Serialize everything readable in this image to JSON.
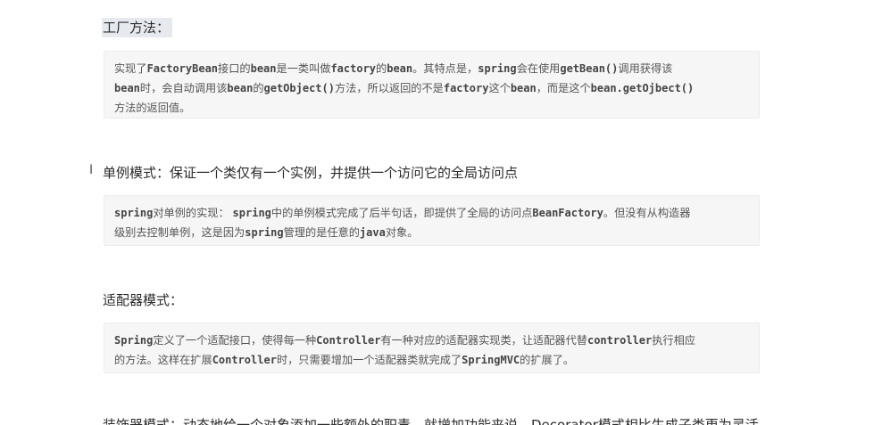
{
  "sections": [
    {
      "heading": "工厂方法：",
      "paragraph": [
        {
          "t": "实现了"
        },
        {
          "t": "FactoryBean",
          "code": true
        },
        {
          "t": "接口的"
        },
        {
          "t": "bean",
          "code": true
        },
        {
          "t": "是一类叫做"
        },
        {
          "t": "factory",
          "code": true
        },
        {
          "t": "的"
        },
        {
          "t": "bean",
          "code": true
        },
        {
          "t": "。其特点是，"
        },
        {
          "t": "spring",
          "code": true
        },
        {
          "t": "会在使用"
        },
        {
          "t": "getBean()",
          "code": true
        },
        {
          "t": "调用获得该"
        },
        {
          "br": true
        },
        {
          "t": "bean",
          "code": true
        },
        {
          "t": "时，会自动调用该"
        },
        {
          "t": "bean",
          "code": true
        },
        {
          "t": "的"
        },
        {
          "t": "getObject()",
          "code": true
        },
        {
          "t": "方法，所以返回的不是"
        },
        {
          "t": "factory",
          "code": true
        },
        {
          "t": "这个"
        },
        {
          "t": "bean",
          "code": true
        },
        {
          "t": "，而是这个"
        },
        {
          "t": "bean.getOjbect()",
          "code": true
        },
        {
          "br": true
        },
        {
          "t": "方法的返回值。"
        }
      ]
    },
    {
      "heading": "单例模式：保证一个类仅有一个实例，并提供一个访问它的全局访问点",
      "paragraph": [
        {
          "t": "spring",
          "code": true
        },
        {
          "t": "对单例的实现：  "
        },
        {
          "t": "spring",
          "code": true
        },
        {
          "t": "中的单例模式完成了后半句话，即提供了全局的访问点"
        },
        {
          "t": "BeanFactory",
          "code": true
        },
        {
          "t": "。但没有从构造器"
        },
        {
          "br": true
        },
        {
          "t": "级别去控制单例，这是因为"
        },
        {
          "t": "spring",
          "code": true
        },
        {
          "t": "管理的是任意的"
        },
        {
          "t": "java",
          "code": true
        },
        {
          "t": "对象。"
        }
      ]
    },
    {
      "heading": "适配器模式：",
      "paragraph": [
        {
          "t": "Spring",
          "code": true
        },
        {
          "t": "定义了一个适配接口，使得每一种"
        },
        {
          "t": "Controller",
          "code": true
        },
        {
          "t": "有一种对应的适配器实现类，让适配器代替"
        },
        {
          "t": "controller",
          "code": true
        },
        {
          "t": "执行相应"
        },
        {
          "br": true
        },
        {
          "t": "的方法。这样在扩展"
        },
        {
          "t": "Controller",
          "code": true
        },
        {
          "t": "时，只需要增加一个适配器类就完成了"
        },
        {
          "t": "SpringMVC",
          "code": true
        },
        {
          "t": "的扩展了。"
        }
      ]
    }
  ],
  "cut_off_heading": "装饰器模式：动态地给一个对象添加一些额外的职责。就增加功能来说，Decorator模式相比生成子类更为灵活。"
}
